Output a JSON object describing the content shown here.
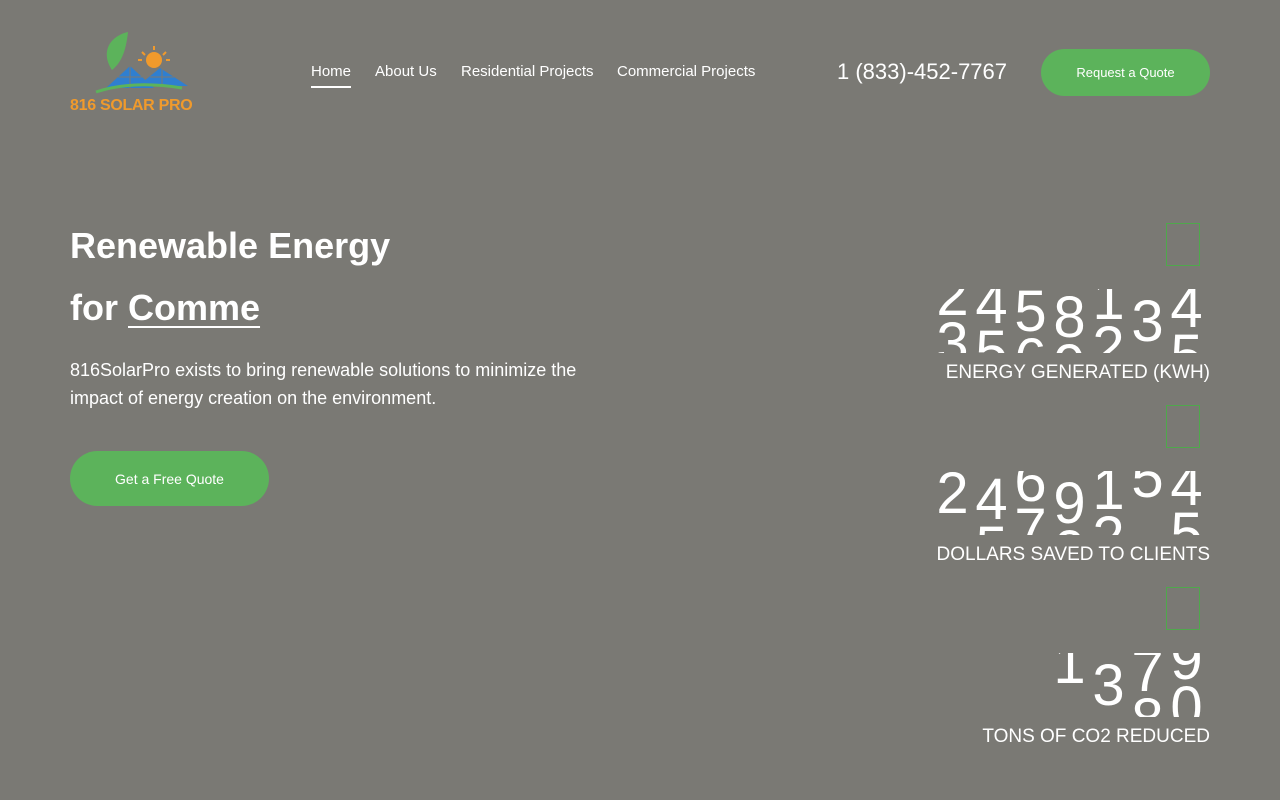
{
  "brand": {
    "logo_text": "816 SOLAR PRO",
    "colors": {
      "accent_green": "#5cb35b",
      "logo_orange": "#f09a2c",
      "logo_blue": "#2f7fd0",
      "background": "#7a7974"
    }
  },
  "nav": {
    "items": [
      {
        "label": "Home",
        "active": true
      },
      {
        "label": "About Us",
        "active": false
      },
      {
        "label": "Residential Projects",
        "active": false
      },
      {
        "label": "Commercial Projects",
        "active": false
      }
    ]
  },
  "header": {
    "phone": "1 (833)-452-7767",
    "cta_label": "Request a Quote"
  },
  "hero": {
    "line1": "Renewable Energy",
    "line2_prefix": "for ",
    "line2_typed": "Comme",
    "description": "816SolarPro exists to bring renewable solutions to minimize the impact of energy creation on the environment.",
    "cta_label": "Get a Free Quote"
  },
  "stats": [
    {
      "label": "ENERGY GENERATED (KWH)",
      "icon": "energy-icon",
      "digits": [
        {
          "top": "2",
          "bottom": "3"
        },
        {
          "top": "4",
          "bottom": "5"
        },
        {
          "top": "5",
          "bottom": "6"
        },
        {
          "top": "8",
          "bottom": "9"
        },
        {
          "top": "1",
          "bottom": "2"
        },
        {
          "top": "3",
          "bottom": ""
        },
        {
          "top": "4",
          "bottom": "5"
        }
      ]
    },
    {
      "label": "DOLLARS SAVED TO CLIENTS",
      "icon": "dollar-icon",
      "digits": [
        {
          "top": "2",
          "bottom": ""
        },
        {
          "top": "4",
          "bottom": "5"
        },
        {
          "top": "6",
          "bottom": "7"
        },
        {
          "top": "9",
          "bottom": "0"
        },
        {
          "top": "1",
          "bottom": "2"
        },
        {
          "top": "5",
          "bottom": ""
        },
        {
          "top": "4",
          "bottom": "5"
        }
      ]
    },
    {
      "label": "TONS OF CO2 REDUCED",
      "icon": "leaf-icon",
      "digits": [
        {
          "top": "1",
          "bottom": ""
        },
        {
          "top": "3",
          "bottom": ""
        },
        {
          "top": "7",
          "bottom": "8"
        },
        {
          "top": "9",
          "bottom": "0"
        }
      ]
    }
  ]
}
